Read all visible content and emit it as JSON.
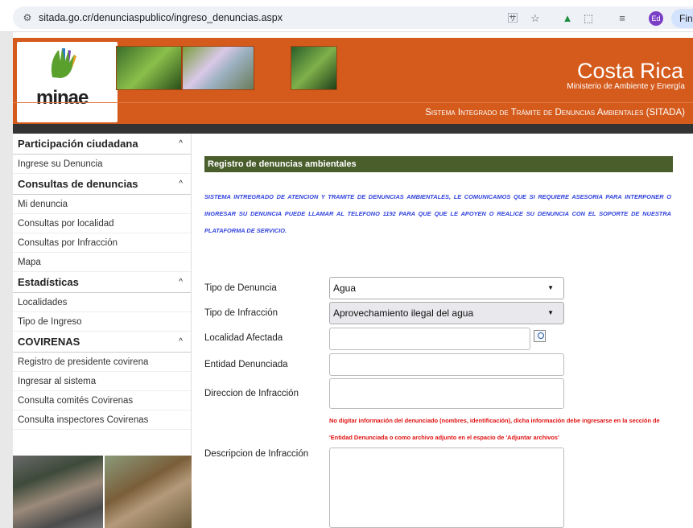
{
  "browser": {
    "url": "sitada.go.cr/denunciaspublico/ingreso_denuncias.aspx",
    "avatar": "Ed",
    "finish_label": "Finis",
    "icons": [
      "tune-icon",
      "translate-icon",
      "star-icon",
      "drive-icon",
      "extensions-icon",
      "reading-list-icon"
    ]
  },
  "header": {
    "logo_text": "minae",
    "country": "Costa Rica",
    "ministry": "Ministerio de Ambiente y Energía",
    "system_name": "Sistema Integrado de Trámite de Denuncias Ambientales (SITADA)",
    "colors": {
      "brand": "#d45b1c",
      "dark_bar": "#333333"
    }
  },
  "sidebar": {
    "sections": [
      {
        "title": "Participación ciudadana",
        "items": [
          "Ingrese su Denuncia"
        ]
      },
      {
        "title": "Consultas de denuncias",
        "items": [
          "Mi denuncia",
          "Consultas por localidad",
          "Consultas por Infracción",
          "Mapa"
        ]
      },
      {
        "title": "Estadísticas",
        "items": [
          "Localidades",
          "Tipo de Ingreso"
        ]
      },
      {
        "title": "COVIRENAS",
        "items": [
          "Registro de presidente covirena",
          "Ingresar al sistema",
          "Consulta comités Covirenas",
          "Consulta inspectores Covirenas"
        ]
      }
    ]
  },
  "main": {
    "title": "Registro de denuncias ambientales",
    "notice": "SISTEMA INTREGRADO DE ATENCION Y TRAMITE DE DENUNCIAS AMBIENTALES, LE COMUNICAMOS QUE SI REQUIERE ASESORIA PARA INTERPONER O INGRESAR SU DENUNCIA PUEDE LLAMAR AL TELEFONO 1192 PARA QUE QUE LE APOYEN O REALICE SU DENUNCIA CON EL SOPORTE DE NUESTRA PLATAFORMA DE SERVICIO.",
    "form": {
      "tipo_denuncia_label": "Tipo de Denuncia",
      "tipo_denuncia_value": "Agua",
      "tipo_infraccion_label": "Tipo de Infracción",
      "tipo_infraccion_value": "Aprovechamiento ilegal del agua",
      "localidad_label": "Localidad Afectada",
      "localidad_value": "",
      "entidad_label": "Entidad Denunciada",
      "entidad_value": "",
      "direccion_label": "Direccion de Infracción",
      "direccion_value": "",
      "warning": "No digitar información del denunciado (nombres, identificación), dicha información debe ingresarse en la sección de 'Entidad Denunciada o como archivo adjunto en el espacio de 'Adjuntar archivos'",
      "descripcion_label": "Descripcion de Infracción",
      "descripcion_value": ""
    },
    "colors": {
      "title_bar": "#4a5e2c",
      "notice": "#3344dd",
      "warning": "#e01010"
    }
  }
}
